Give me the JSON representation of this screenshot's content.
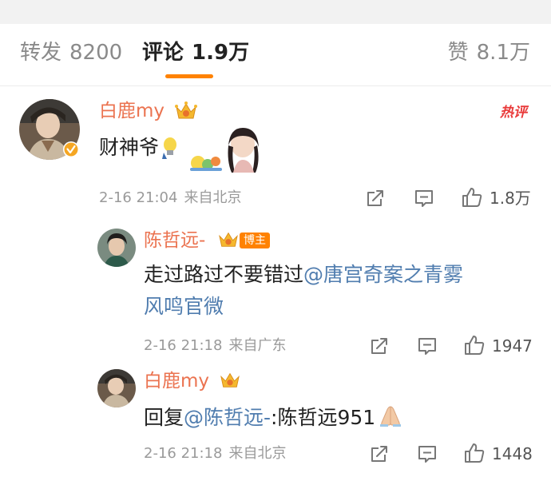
{
  "tabs": {
    "repost": {
      "label": "转发",
      "count": "8200"
    },
    "comment": {
      "label": "评论",
      "count": "1.9万"
    },
    "like": {
      "label": "赞",
      "count": "8.1万"
    }
  },
  "colors": {
    "accent": "#ff8200",
    "username": "#eb7350",
    "mention": "#507daf",
    "hot": "#e93a3a"
  },
  "comments": [
    {
      "user": "白鹿my",
      "badge": "热评",
      "text": "财神爷",
      "time": "2-16 21:04",
      "location": "来自北京",
      "likes": "1.8万"
    },
    {
      "user": "陈哲远-",
      "tag": "博主",
      "text_prefix": "走过路过不要错过",
      "mention": "@唐宫奇案之青雾",
      "mention_cont": "风鸣官微",
      "time": "2-16 21:18",
      "location": "来自广东",
      "likes": "1947"
    },
    {
      "user": "白鹿my",
      "text_prefix": "回复",
      "mention": "@陈哲远-",
      "text_suffix": ":陈哲远951",
      "time": "2-16 21:18",
      "location": "来自北京",
      "likes": "1448"
    }
  ],
  "icons": [
    "share-icon",
    "comment-icon",
    "like-icon",
    "crown-badge-icon",
    "verified-icon",
    "praying-hands-icon",
    "lightbulb-icon"
  ]
}
